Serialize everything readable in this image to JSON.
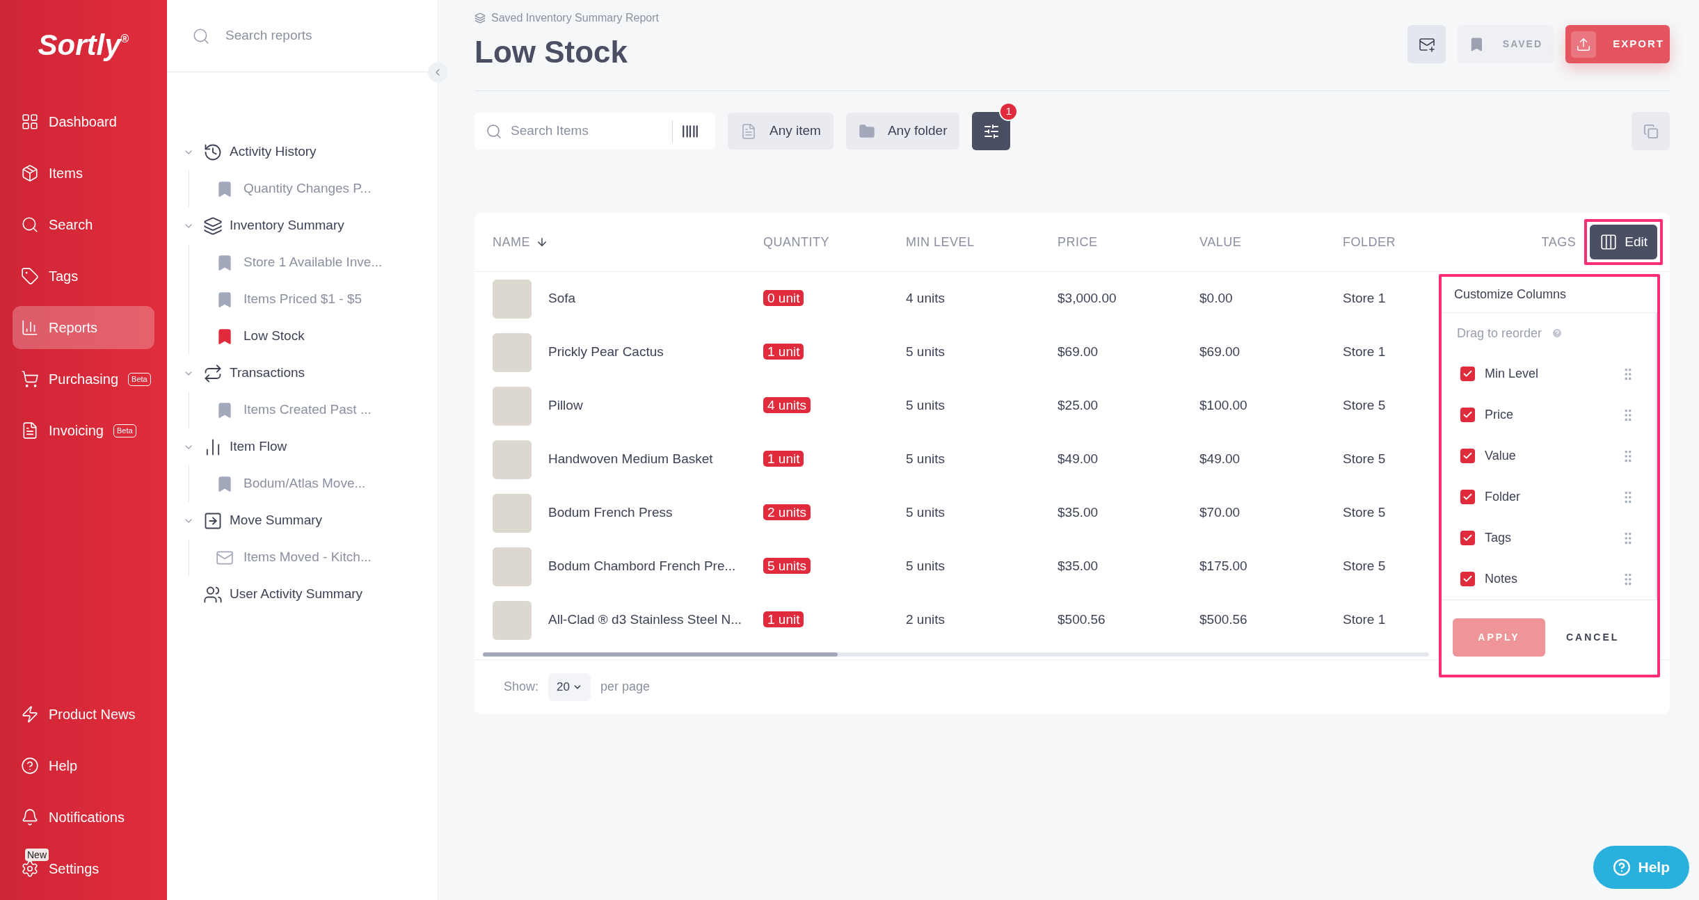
{
  "sidebar": {
    "logo": "Sortly",
    "logo_mark": "®",
    "nav": [
      {
        "label": "Dashboard",
        "kind": "dashboard",
        "selected": false
      },
      {
        "label": "Items",
        "kind": "items",
        "selected": false
      },
      {
        "label": "Search",
        "kind": "search",
        "selected": false
      },
      {
        "label": "Tags",
        "kind": "tags",
        "selected": false
      },
      {
        "label": "Reports",
        "kind": "reports",
        "selected": true
      },
      {
        "label": "Purchasing",
        "kind": "purchasing",
        "badge": "Beta",
        "selected": false
      },
      {
        "label": "Invoicing",
        "kind": "invoicing",
        "badge": "Beta",
        "selected": false
      }
    ],
    "bottom_nav": [
      {
        "label": "Product News",
        "kind": "news"
      },
      {
        "label": "Help",
        "kind": "help"
      },
      {
        "label": "Notifications",
        "kind": "notifications"
      },
      {
        "label": "Settings",
        "kind": "settings",
        "badge": "New"
      }
    ]
  },
  "report_tree": {
    "search": {
      "placeholder": "Search reports"
    },
    "groups": [
      {
        "label": "Activity History",
        "kind": "history",
        "expanded": true,
        "children": [
          {
            "label": "Quantity Changes P...",
            "kind": "bookmark",
            "selected": false
          }
        ]
      },
      {
        "label": "Inventory Summary",
        "kind": "layers",
        "expanded": true,
        "children": [
          {
            "label": "Store 1 Available Inve...",
            "kind": "bookmark",
            "selected": false
          },
          {
            "label": "Items Priced $1 - $5",
            "kind": "bookmark",
            "selected": false
          },
          {
            "label": "Low Stock",
            "kind": "bookmark",
            "selected": true
          }
        ]
      },
      {
        "label": "Transactions",
        "kind": "transactions",
        "expanded": true,
        "children": [
          {
            "label": "Items Created Past ...",
            "kind": "bookmark",
            "selected": false
          }
        ]
      },
      {
        "label": "Item Flow",
        "kind": "flow",
        "expanded": true,
        "children": [
          {
            "label": "Bodum/Atlas Move...",
            "kind": "bookmark",
            "selected": false
          }
        ]
      },
      {
        "label": "Move Summary",
        "kind": "move",
        "expanded": true,
        "children": [
          {
            "label": "Items Moved - Kitch...",
            "kind": "scheduled",
            "selected": false
          }
        ]
      },
      {
        "label": "User Activity Summary",
        "kind": "users"
      }
    ]
  },
  "header": {
    "breadcrumb": "Saved Inventory Summary Report",
    "title": "Low Stock",
    "actions": [
      {
        "kind": "email",
        "disabled": false
      },
      {
        "kind": "saved",
        "label": "SAVED",
        "disabled": true
      },
      {
        "kind": "export",
        "label": "EXPORT",
        "disabled": false
      }
    ]
  },
  "toolbar": {
    "search": {
      "placeholder": "Search Items"
    },
    "filters": [
      {
        "label": "Any item",
        "kind": "file"
      },
      {
        "label": "Any folder",
        "kind": "folder"
      }
    ],
    "filter_count": "1"
  },
  "table": {
    "columns": [
      {
        "label": "NAME",
        "sorted": true
      },
      {
        "label": "QUANTITY",
        "sorted": false
      },
      {
        "label": "MIN LEVEL",
        "sorted": false
      },
      {
        "label": "PRICE",
        "sorted": false
      },
      {
        "label": "VALUE",
        "sorted": false
      },
      {
        "label": "FOLDER",
        "sorted": false
      },
      {
        "label": "TAGS",
        "sorted": false
      }
    ],
    "edit_button": "Edit",
    "rows": [
      {
        "name": "Sofa",
        "quantity": "0 unit",
        "min_level": "4 units",
        "price": "$3,000.00",
        "value": "$0.00",
        "folder": "Store 1"
      },
      {
        "name": "Prickly Pear Cactus",
        "quantity": "1 unit",
        "min_level": "5 units",
        "price": "$69.00",
        "value": "$69.00",
        "folder": "Store 1"
      },
      {
        "name": "Pillow",
        "quantity": "4 units",
        "min_level": "5 units",
        "price": "$25.00",
        "value": "$100.00",
        "folder": "Store 5"
      },
      {
        "name": "Handwoven Medium Basket",
        "quantity": "1 unit",
        "min_level": "5 units",
        "price": "$49.00",
        "value": "$49.00",
        "folder": "Store 5"
      },
      {
        "name": "Bodum French Press",
        "quantity": "2 units",
        "min_level": "5 units",
        "price": "$35.00",
        "value": "$70.00",
        "folder": "Store 5"
      },
      {
        "name": "Bodum Chambord French Pre...",
        "quantity": "5 units",
        "min_level": "5 units",
        "price": "$35.00",
        "value": "$175.00",
        "folder": "Store 5"
      },
      {
        "name": "All-Clad ® d3 Stainless Steel N...",
        "quantity": "1 unit",
        "min_level": "2 units",
        "price": "$500.56",
        "value": "$500.56",
        "folder": "Store 1"
      }
    ],
    "pagination": {
      "label": "Show:",
      "page_size": "20",
      "suffix": "per page"
    }
  },
  "customize_columns": {
    "title": "Customize Columns",
    "hint": "Drag to reorder",
    "columns": [
      {
        "label": "Min Level",
        "checked": true
      },
      {
        "label": "Price",
        "checked": true
      },
      {
        "label": "Value",
        "checked": true
      },
      {
        "label": "Folder",
        "checked": true
      },
      {
        "label": "Tags",
        "checked": true
      },
      {
        "label": "Notes",
        "checked": true
      }
    ],
    "apply": {
      "label": "APPLY",
      "disabled": true
    },
    "cancel": "CANCEL"
  },
  "help_button": "Help"
}
